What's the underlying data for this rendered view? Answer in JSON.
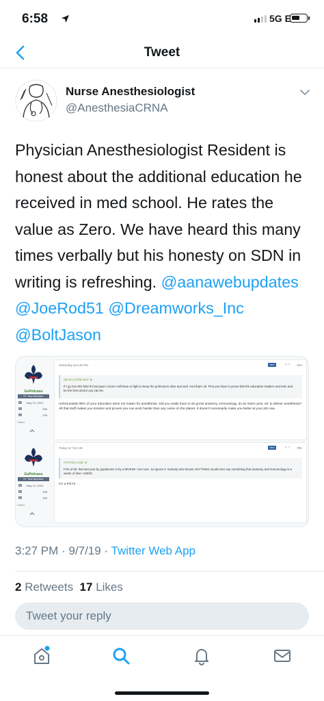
{
  "status_bar": {
    "time": "6:58",
    "network": "5G E"
  },
  "nav": {
    "title": "Tweet"
  },
  "author": {
    "name": "Nurse Anesthesiologist",
    "handle": "@AnesthesiaCRNA"
  },
  "tweet": {
    "text_plain": "Physician Anesthesiologist Resident is honest about the additional education he received in med school. He rates the value as Zero. We have heard this many times verbally but his honesty on SDN in writing is refreshing. ",
    "mentions": [
      "@aanawebupdates",
      "@JoeRod51",
      "@Dreamworks_Inc",
      "@BoltJason"
    ]
  },
  "embed": {
    "posts": [
      {
        "username": "GoPelicans",
        "member_label": "5+ Year Member",
        "joined": "May 13, 2013",
        "messages": "598",
        "reactions": "295",
        "status_label": "Status",
        "date": "Yesterday at 6:40 PM",
        "badge": "New",
        "post_number": "#84",
        "quote_header": "Wintercomfid said: ⊕",
        "quote_text": "If I go into this field it's because I know I will have to fight to keep the profession alive and well. And that's ok. First you have to prove that the education matters and train and be the best doctor you can be.",
        "body": "Unfortunately 90% of your education does not matter for anesthesia. Did you really have to do gross anatomy, immunology, do an intern year, etc to deliver anesthesia? All that stuff makes you smarter and proves you can work harder than any nurse on the planet. It doesn't necessarily make you better at your job now."
      },
      {
        "username": "GoPelicans",
        "member_label": "5+ Year Member",
        "joined": "May 13, 2013",
        "messages": "598",
        "reactions": "295",
        "status_label": "Status",
        "date": "Today at 7:11 AM",
        "badge": "New",
        "post_number": "#91",
        "quote_header": "PreOtimy said: ⊕",
        "quote_text": "First of all, that last post by gopelicans is by a MURSE I am sure. So ignore it. Nobody who knows ANYTHING would ever say something that anatomy and immunology is a waste of time. CMON",
        "body": "I'm a PGY2"
      }
    ]
  },
  "meta": {
    "time": "3:27 PM",
    "date": "9/7/19",
    "separator": "·",
    "source": "Twitter Web App"
  },
  "counts": {
    "retweets_value": "2",
    "retweets_label": "Retweets",
    "likes_value": "17",
    "likes_label": "Likes"
  },
  "reply": {
    "placeholder": "Tweet your reply"
  },
  "colors": {
    "accent": "#1da1f2",
    "secondary_text": "#657786",
    "divider": "#e1e8ed"
  },
  "icons": [
    "back-chevron-icon",
    "more-caret-icon",
    "home-icon",
    "search-icon",
    "notifications-icon",
    "messages-icon"
  ]
}
